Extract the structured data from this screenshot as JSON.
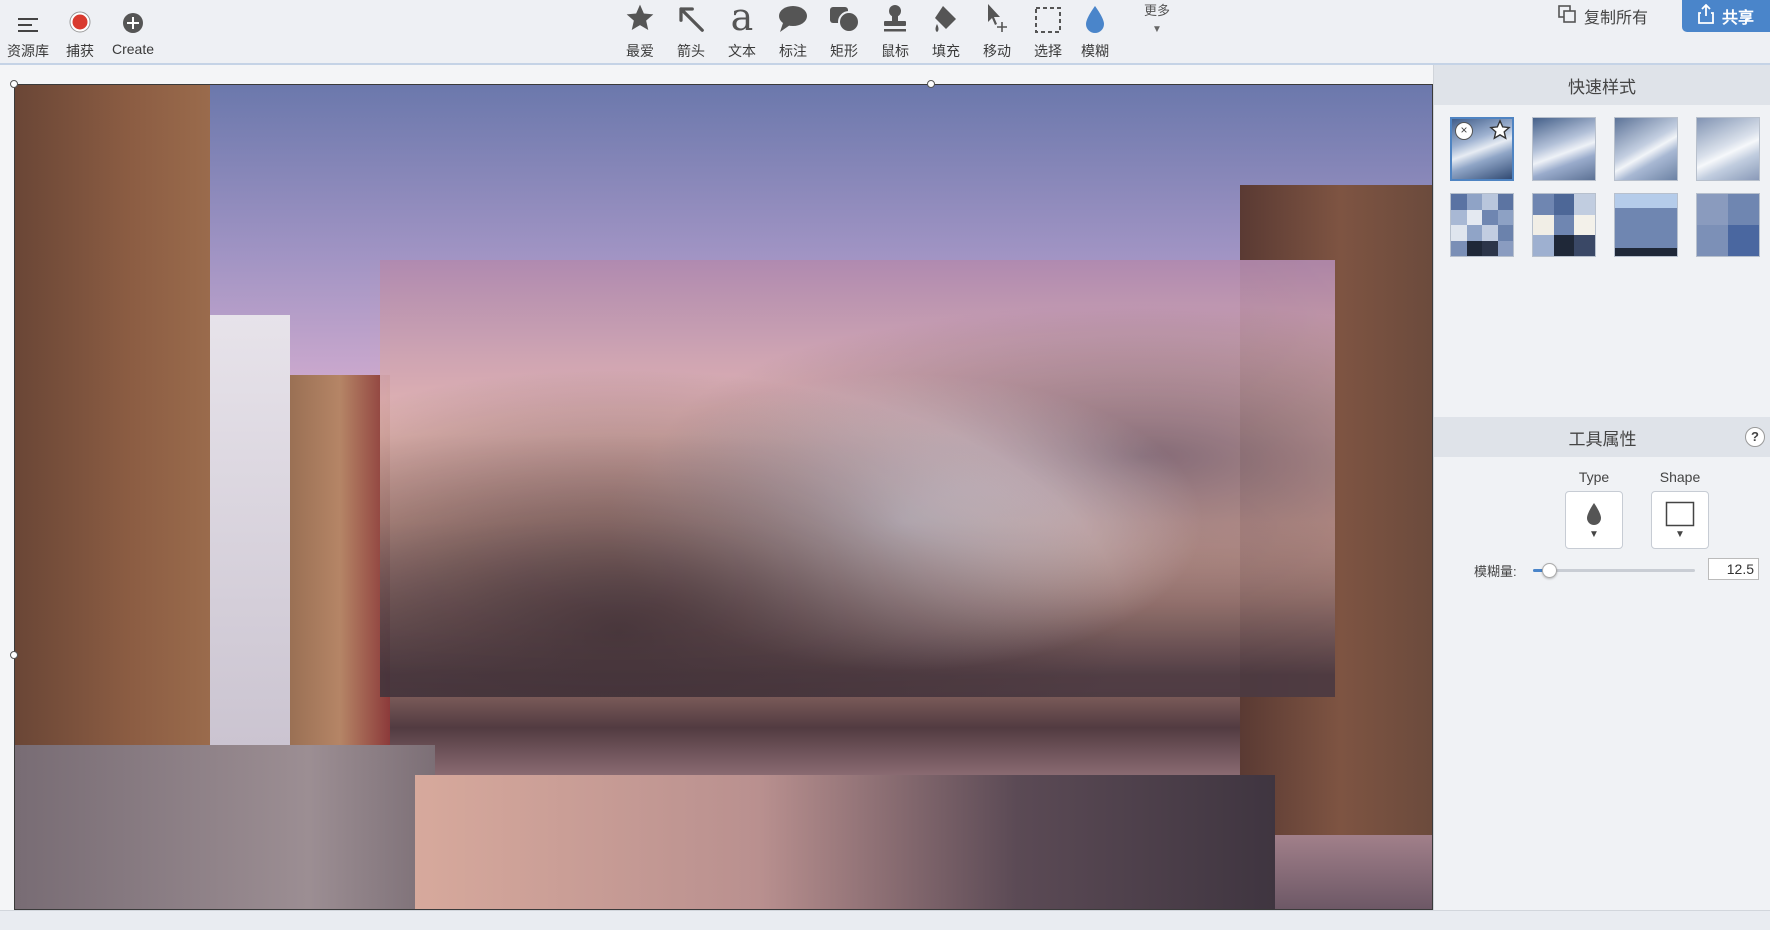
{
  "toolbar": {
    "left": [
      {
        "label": "资源库",
        "icon": "menu-icon"
      },
      {
        "label": "捕获",
        "icon": "record-icon"
      },
      {
        "label": "Create",
        "icon": "plus-circle-icon"
      }
    ],
    "tools": [
      {
        "label": "最爱",
        "icon": "star-icon"
      },
      {
        "label": "箭头",
        "icon": "arrow-icon"
      },
      {
        "label": "文本",
        "icon": "text-icon"
      },
      {
        "label": "标注",
        "icon": "callout-icon"
      },
      {
        "label": "矩形",
        "icon": "shapes-icon"
      },
      {
        "label": "鼠标",
        "icon": "stamp-icon"
      },
      {
        "label": "填充",
        "icon": "fill-icon"
      },
      {
        "label": "移动",
        "icon": "move-icon"
      },
      {
        "label": "选择",
        "icon": "select-icon"
      },
      {
        "label": "模糊",
        "icon": "blur-drop-icon"
      }
    ],
    "more_label": "更多",
    "copy_all_label": "复制所有",
    "share_label": "共享"
  },
  "panel": {
    "quick_styles_title": "快速样式",
    "tool_props_title": "工具属性",
    "help_label": "?",
    "type_label": "Type",
    "shape_label": "Shape",
    "blur_amount_label": "模糊量:",
    "blur_amount_value": "12.5",
    "blur_amount_fraction": 0.1
  },
  "colors": {
    "accent": "#4a85ca",
    "toolbar_bg": "#eef0f4",
    "record": "#d93a2e"
  }
}
